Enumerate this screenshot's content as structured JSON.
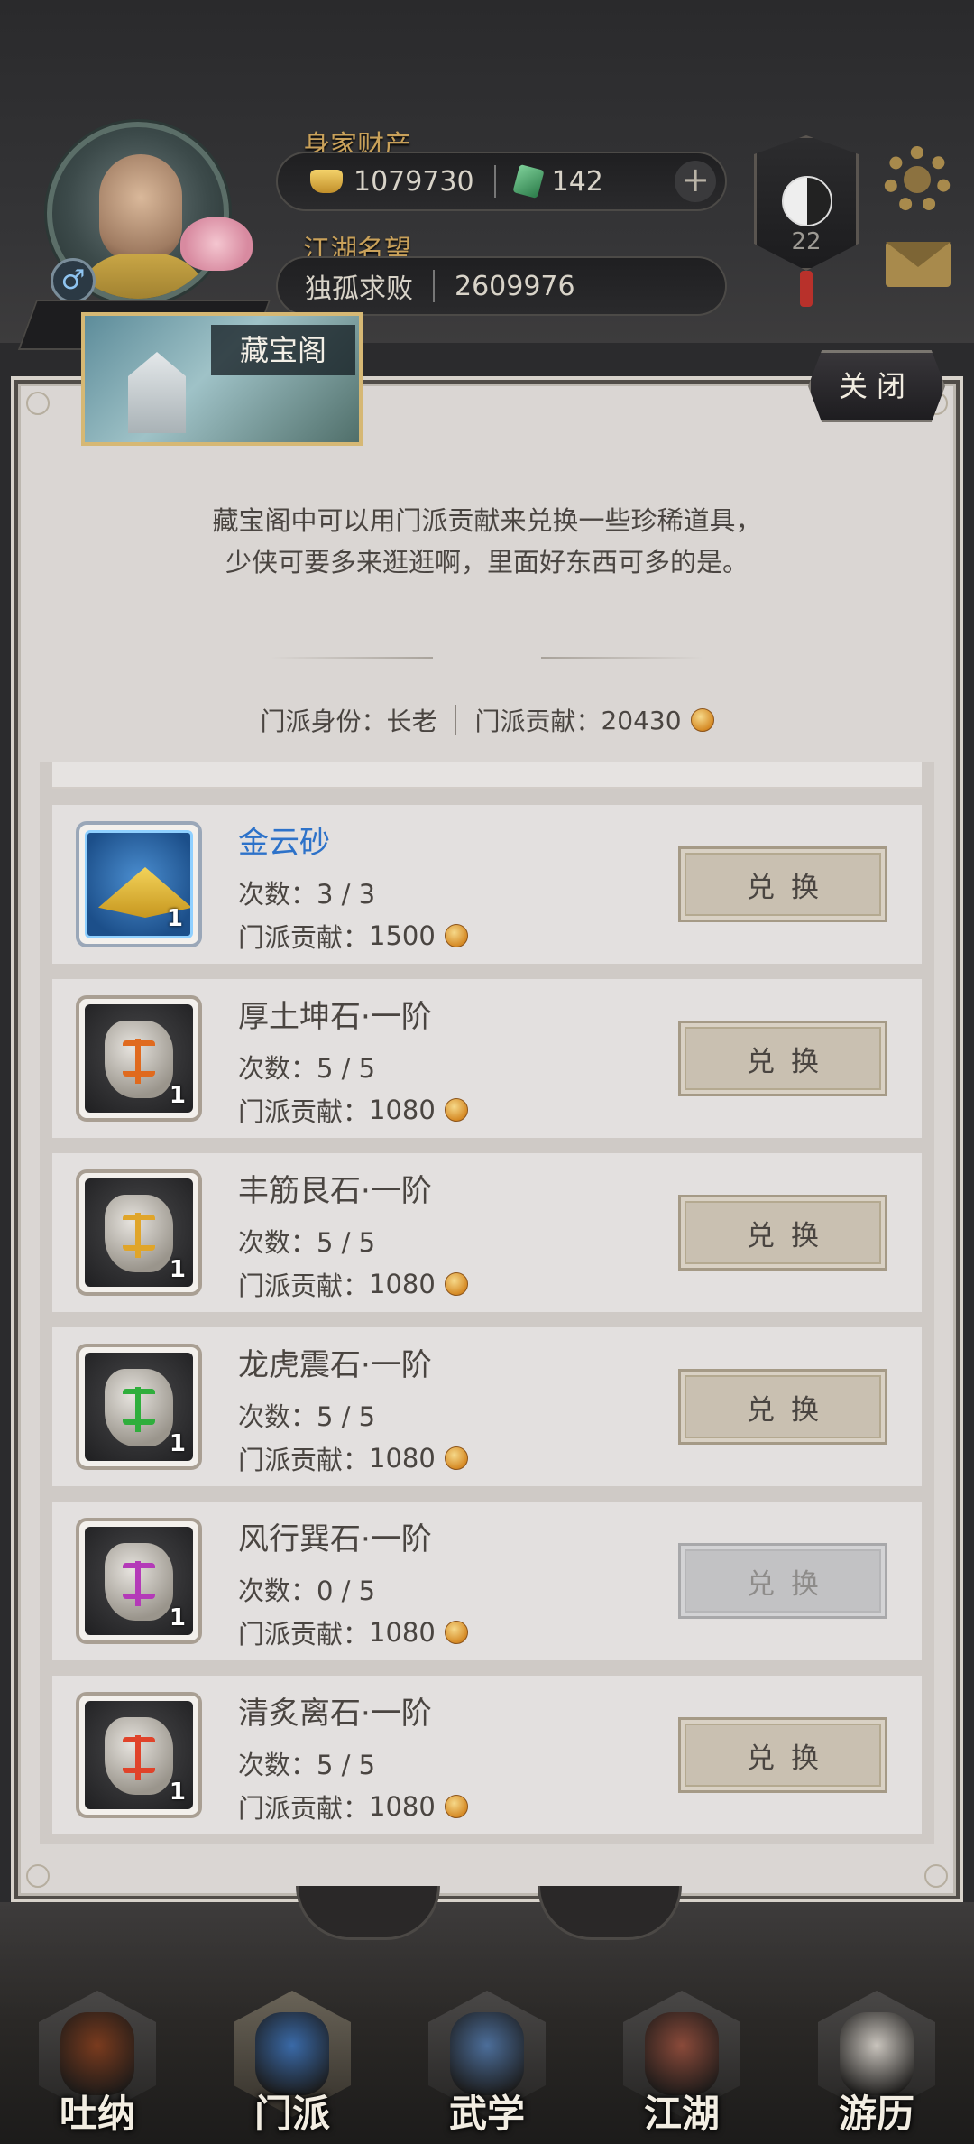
{
  "header": {
    "wealth_label": "身家财产",
    "gold": "1079730",
    "jade": "142",
    "plus": "+",
    "fame_label": "江湖名望",
    "fame_title": "独孤求败",
    "fame_value": "2609976",
    "level": "22",
    "gender_symbol": "♂"
  },
  "modal": {
    "title": "藏宝阁",
    "close_label": "关闭",
    "intro_line1": "藏宝阁中可以用门派贡献来兑换一些珍稀道具，",
    "intro_line2": "少侠可要多来逛逛啊，里面好东西可多的是。",
    "sect_role_label": "门派身份：",
    "sect_role": "长老",
    "contribution_label": "门派贡献：",
    "contribution": "20430"
  },
  "items": [
    {
      "name": "金云砂",
      "count_label": "次数：",
      "count": "3 / 3",
      "cost_label": "门派贡献：",
      "cost": "1500",
      "qty": "1",
      "button": "兑换",
      "enabled": true,
      "color": "#2d72c9",
      "icon": "golden-sand-icon"
    },
    {
      "name": "厚土坤石·一阶",
      "count_label": "次数：",
      "count": "5 / 5",
      "cost_label": "门派贡献：",
      "cost": "1080",
      "qty": "1",
      "button": "兑换",
      "enabled": true,
      "color": "#e06a1e",
      "icon": "earth-stone-icon"
    },
    {
      "name": "丰筋艮石·一阶",
      "count_label": "次数：",
      "count": "5 / 5",
      "cost_label": "门派贡献：",
      "cost": "1080",
      "qty": "1",
      "button": "兑换",
      "enabled": true,
      "color": "#e0a52a",
      "icon": "mountain-stone-icon"
    },
    {
      "name": "龙虎震石·一阶",
      "count_label": "次数：",
      "count": "5 / 5",
      "cost_label": "门派贡献：",
      "cost": "1080",
      "qty": "1",
      "button": "兑换",
      "enabled": true,
      "color": "#2fae3c",
      "icon": "thunder-stone-icon"
    },
    {
      "name": "风行巽石·一阶",
      "count_label": "次数：",
      "count": "0 / 5",
      "cost_label": "门派贡献：",
      "cost": "1080",
      "qty": "1",
      "button": "兑换",
      "enabled": false,
      "color": "#b43ab8",
      "icon": "wind-stone-icon"
    },
    {
      "name": "清炙离石·一阶",
      "count_label": "次数：",
      "count": "5 / 5",
      "cost_label": "门派贡献：",
      "cost": "1080",
      "qty": "1",
      "button": "兑换",
      "enabled": true,
      "color": "#e0432a",
      "icon": "fire-stone-icon"
    }
  ],
  "nav": [
    {
      "label": "吐纳",
      "icon": "meditation-icon",
      "active": false,
      "art": "#7a3b1e"
    },
    {
      "label": "门派",
      "icon": "sect-icon",
      "active": true,
      "art": "#3a6aa8"
    },
    {
      "label": "武学",
      "icon": "martial-book-icon",
      "active": false,
      "art": "#4c6e9a"
    },
    {
      "label": "江湖",
      "icon": "straw-hat-icon",
      "active": false,
      "art": "#8a4a3a"
    },
    {
      "label": "游历",
      "icon": "horse-icon",
      "active": false,
      "art": "#c9c4bd"
    }
  ]
}
